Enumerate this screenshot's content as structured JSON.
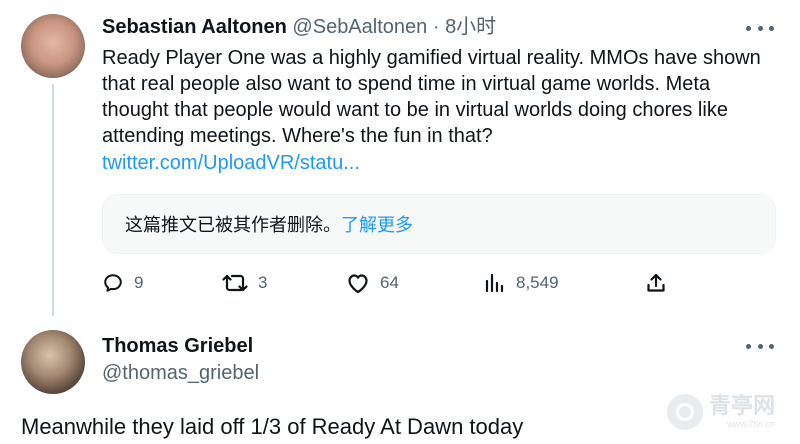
{
  "tweet1": {
    "name": "Sebastian Aaltonen",
    "handle": "@SebAaltonen",
    "separator": "·",
    "time": "8小时",
    "text": "Ready Player One was a highly gamified virtual reality. MMOs have shown that real people also want to spend time in virtual game worlds. Meta thought that people would want to be in virtual worlds doing chores like attending meetings. Where's the fun in that?",
    "link": "twitter.com/UploadVR/statu...",
    "quote": {
      "deleted_text": "这篇推文已被其作者删除。",
      "learn_more": "了解更多"
    },
    "actions": {
      "replies": "9",
      "retweets": "3",
      "likes": "64",
      "views": "8,549"
    }
  },
  "tweet2": {
    "name": "Thomas Griebel",
    "handle": "@thomas_griebel",
    "text": "Meanwhile they laid off 1/3 of Ready At Dawn today"
  },
  "watermark": {
    "text": "青亭网",
    "url": "www.7tin.cn"
  },
  "colors": {
    "text": "#0f1419",
    "secondary": "#536471",
    "link": "#1d9bf0",
    "card_bg": "#f7f9f9"
  }
}
